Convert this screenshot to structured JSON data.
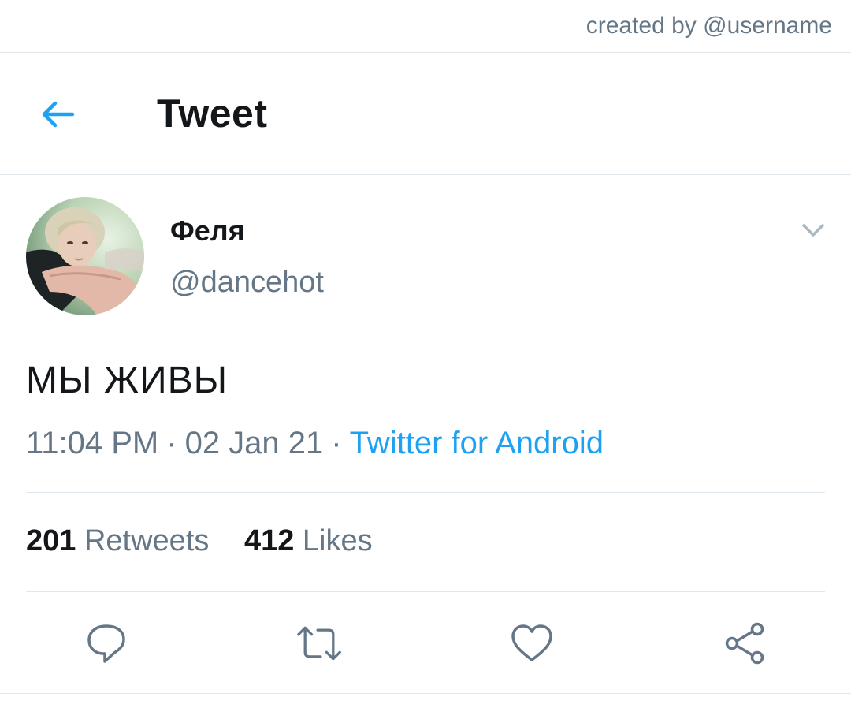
{
  "watermark": "created by @username",
  "header": {
    "title": "Tweet",
    "back_icon": "arrow-left-icon"
  },
  "colors": {
    "accent": "#1da1f2",
    "muted": "#657786",
    "text": "#14171a",
    "divider": "#e1e8ed"
  },
  "user": {
    "display_name": "Феля",
    "handle": "@dancehot"
  },
  "tweet": {
    "text": "МЫ ЖИВЫ",
    "time": "11:04 PM",
    "date": "02 Jan 21",
    "separator": "·",
    "source": "Twitter for Android"
  },
  "stats": {
    "retweets_count": "201",
    "retweets_label": "Retweets",
    "likes_count": "412",
    "likes_label": "Likes"
  },
  "actions": [
    {
      "name": "reply",
      "icon": "reply-icon"
    },
    {
      "name": "retweet",
      "icon": "retweet-icon"
    },
    {
      "name": "like",
      "icon": "heart-icon"
    },
    {
      "name": "share",
      "icon": "share-icon"
    }
  ]
}
